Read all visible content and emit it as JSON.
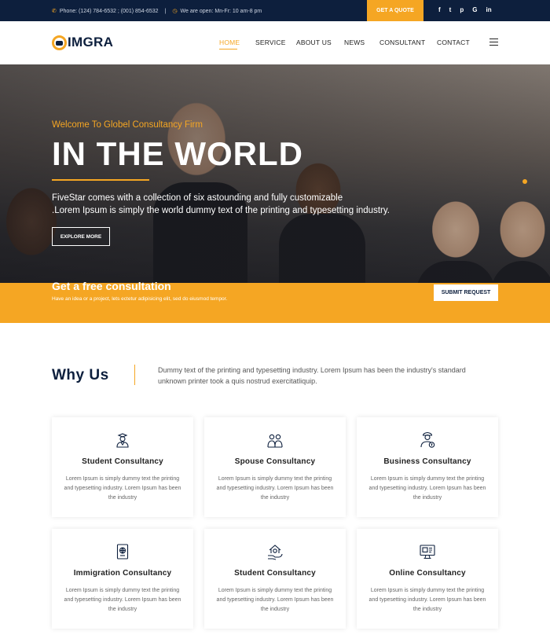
{
  "topbar": {
    "phone": "Phone: (124) 784-6532 ; (001) 854-6532",
    "separator": "|",
    "hours": "We are open: Mn-Fr: 10 am-8 pm",
    "quote_label": "GET A QUOTE",
    "social": [
      "f",
      "t",
      "p",
      "G",
      "in"
    ]
  },
  "nav": {
    "logo_text": "IMGRA",
    "items": [
      "HOME",
      "SERVICE",
      "ABOUT US",
      "NEWS",
      "CONSULTANT",
      "CONTACT"
    ]
  },
  "hero": {
    "kicker": "Welcome To Globel Consultancy Firm",
    "title": "IN THE WORLD",
    "desc_line1": "FiveStar comes with a collection of six astounding and fully customizable",
    "desc_line2": ".Lorem Ipsum is simply the world dummy text of the printing and typesetting industry.",
    "button": "EXPLORE MORE"
  },
  "band": {
    "title": "Get a free consultation",
    "subtitle": "Have an idea or a project, lets ectetur adipisicing elit, sed do eiusmod tempor.",
    "button": "SUBMIT REQUEST"
  },
  "why": {
    "title": "Why Us",
    "text": "Dummy text of the printing and typesetting industry. Lorem Ipsum has been the industry's standard unknown printer took a quis nostrud exercitatliquip."
  },
  "cards": [
    {
      "title": "Student Consultancy",
      "icon": "student-icon",
      "text": "Lorem Ipsum is simply dummy text the printing and typesetting industry. Lorem Ipsum has been the industry"
    },
    {
      "title": "Spouse Consultancy",
      "icon": "couple-icon",
      "text": "Lorem Ipsum is simply dummy text the printing and typesetting industry. Lorem Ipsum has been the industry"
    },
    {
      "title": "Business Consultancy",
      "icon": "businessman-icon",
      "text": "Lorem Ipsum is simply dummy text the printing and typesetting industry. Lorem Ipsum has been the industry"
    },
    {
      "title": "Immigration Consultancy",
      "icon": "passport-icon",
      "text": "Lorem Ipsum is simply dummy text the printing and typesetting industry. Lorem Ipsum has been the industry"
    },
    {
      "title": "Student Consultancy",
      "icon": "house-hand-icon",
      "text": "Lorem Ipsum is simply dummy text the printing and typesetting industry. Lorem Ipsum has been the industry"
    },
    {
      "title": "Online Consultancy",
      "icon": "monitor-icon",
      "text": "Lorem Ipsum is simply dummy text the printing and typesetting industry. Lorem Ipsum has been the industry"
    }
  ],
  "colors": {
    "accent": "#f5a623",
    "navy": "#0d1f3d"
  }
}
